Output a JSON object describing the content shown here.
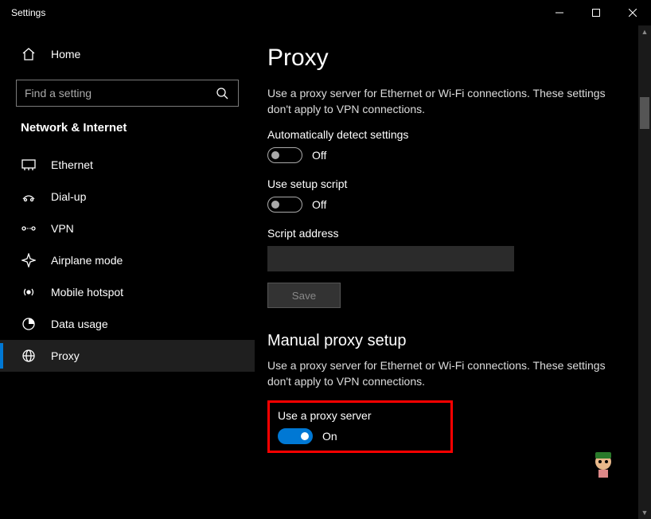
{
  "window": {
    "title": "Settings"
  },
  "sidebar": {
    "home": "Home",
    "search_placeholder": "Find a setting",
    "category": "Network & Internet",
    "items": [
      {
        "label": "Ethernet"
      },
      {
        "label": "Dial-up"
      },
      {
        "label": "VPN"
      },
      {
        "label": "Airplane mode"
      },
      {
        "label": "Mobile hotspot"
      },
      {
        "label": "Data usage"
      },
      {
        "label": "Proxy"
      }
    ]
  },
  "main": {
    "title": "Proxy",
    "desc1": "Use a proxy server for Ethernet or Wi-Fi connections. These settings don't apply to VPN connections.",
    "auto_detect_label": "Automatically detect settings",
    "auto_detect_state": "Off",
    "setup_script_label": "Use setup script",
    "setup_script_state": "Off",
    "script_address_label": "Script address",
    "script_address_value": "",
    "save_label": "Save",
    "manual_title": "Manual proxy setup",
    "desc2": "Use a proxy server for Ethernet or Wi-Fi connections. These settings don't apply to VPN connections.",
    "use_proxy_label": "Use a proxy server",
    "use_proxy_state": "On"
  }
}
